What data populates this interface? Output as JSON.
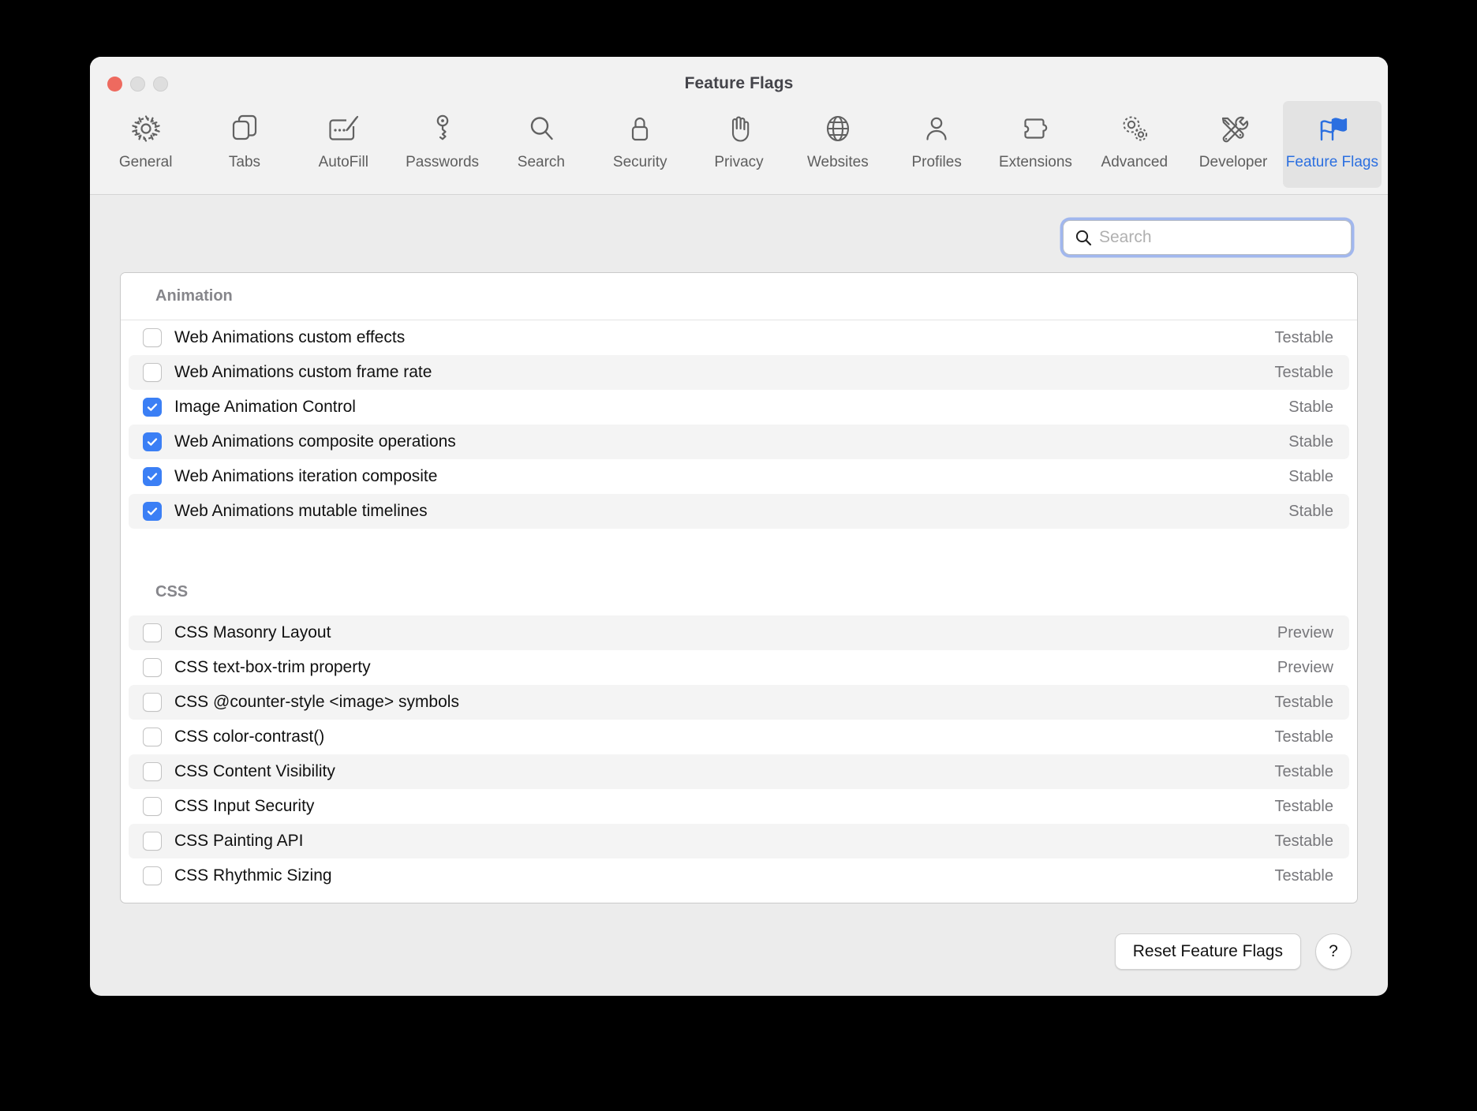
{
  "window": {
    "title": "Feature Flags",
    "traffic_lights": [
      "close-button",
      "minimize-button",
      "maximize-button"
    ]
  },
  "toolbar": {
    "items": [
      {
        "label": "General",
        "icon": "gear-icon",
        "selected": false
      },
      {
        "label": "Tabs",
        "icon": "tabs-icon",
        "selected": false
      },
      {
        "label": "AutoFill",
        "icon": "autofill-icon",
        "selected": false
      },
      {
        "label": "Passwords",
        "icon": "key-icon",
        "selected": false
      },
      {
        "label": "Search",
        "icon": "magnifier-icon",
        "selected": false
      },
      {
        "label": "Security",
        "icon": "lock-icon",
        "selected": false
      },
      {
        "label": "Privacy",
        "icon": "hand-icon",
        "selected": false
      },
      {
        "label": "Websites",
        "icon": "globe-icon",
        "selected": false
      },
      {
        "label": "Profiles",
        "icon": "person-icon",
        "selected": false
      },
      {
        "label": "Extensions",
        "icon": "puzzle-icon",
        "selected": false
      },
      {
        "label": "Advanced",
        "icon": "gears-icon",
        "selected": false
      },
      {
        "label": "Developer",
        "icon": "tools-icon",
        "selected": false
      },
      {
        "label": "Feature Flags",
        "icon": "flags-icon",
        "selected": true
      }
    ]
  },
  "search": {
    "placeholder": "Search",
    "value": "",
    "icon": "search-icon"
  },
  "sections": [
    {
      "title": "Animation",
      "rows": [
        {
          "label": "Web Animations custom effects",
          "checked": false,
          "status": "Testable",
          "striped": false
        },
        {
          "label": "Web Animations custom frame rate",
          "checked": false,
          "status": "Testable",
          "striped": true
        },
        {
          "label": "Image Animation Control",
          "checked": true,
          "status": "Stable",
          "striped": false
        },
        {
          "label": "Web Animations composite operations",
          "checked": true,
          "status": "Stable",
          "striped": true
        },
        {
          "label": "Web Animations iteration composite",
          "checked": true,
          "status": "Stable",
          "striped": false
        },
        {
          "label": "Web Animations mutable timelines",
          "checked": true,
          "status": "Stable",
          "striped": true
        }
      ]
    },
    {
      "title": "CSS",
      "rows": [
        {
          "label": "CSS Masonry Layout",
          "checked": false,
          "status": "Preview",
          "striped": true
        },
        {
          "label": "CSS text-box-trim property",
          "checked": false,
          "status": "Preview",
          "striped": false
        },
        {
          "label": "CSS @counter-style <image> symbols",
          "checked": false,
          "status": "Testable",
          "striped": true
        },
        {
          "label": "CSS color-contrast()",
          "checked": false,
          "status": "Testable",
          "striped": false
        },
        {
          "label": "CSS Content Visibility",
          "checked": false,
          "status": "Testable",
          "striped": true
        },
        {
          "label": "CSS Input Security",
          "checked": false,
          "status": "Testable",
          "striped": false
        },
        {
          "label": "CSS Painting API",
          "checked": false,
          "status": "Testable",
          "striped": true
        },
        {
          "label": "CSS Rhythmic Sizing",
          "checked": false,
          "status": "Testable",
          "striped": false
        }
      ]
    }
  ],
  "footer": {
    "reset_label": "Reset Feature Flags",
    "help_label": "?"
  },
  "colors": {
    "accent": "#3b7ff5",
    "selected_tab_text": "#2b6fe0",
    "window_bg": "#ececec",
    "titlebar_bg": "#f2f2f2",
    "stripe": "#f4f4f4",
    "status_text": "#77777b",
    "section_header_text": "#86868b",
    "close_button": "#ee6a5f"
  }
}
